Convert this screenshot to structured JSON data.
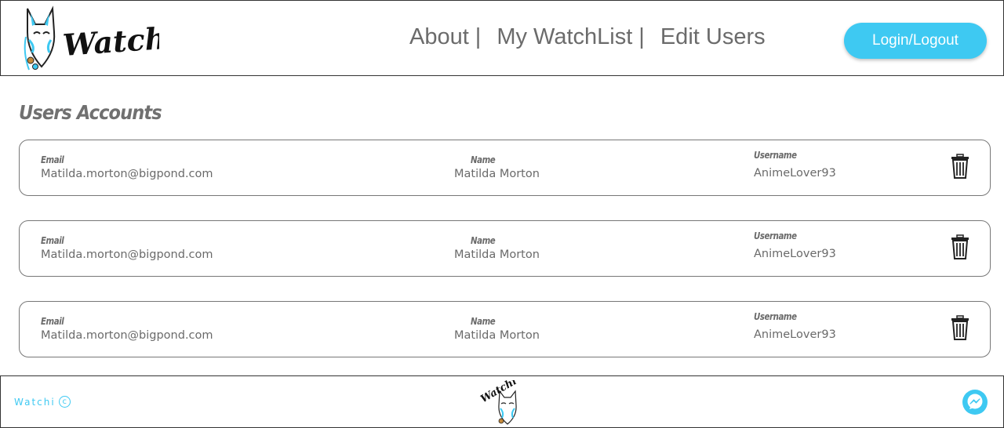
{
  "header": {
    "logo_text": "Watchi",
    "nav": [
      {
        "label": "About",
        "sep": "|"
      },
      {
        "label": "My WatchList",
        "sep": "|"
      },
      {
        "label": "Edit Users",
        "sep": ""
      }
    ],
    "login_label": "Login/Logout"
  },
  "page": {
    "title": "Users Accounts"
  },
  "labels": {
    "email": "Email",
    "name": "Name",
    "username": "Username"
  },
  "users": [
    {
      "email": "Matilda.morton@bigpond.com",
      "name": "Matilda Morton",
      "username": "AnimeLover93"
    },
    {
      "email": "Matilda.morton@bigpond.com",
      "name": "Matilda Morton",
      "username": "AnimeLover93"
    },
    {
      "email": "Matilda.morton@bigpond.com",
      "name": "Matilda Morton",
      "username": "AnimeLover93"
    }
  ],
  "footer": {
    "brand": "Watchi",
    "copyright_symbol": "c",
    "logo_text": "Watchi"
  },
  "icons": {
    "delete": "trash-icon",
    "chat": "messenger-icon"
  },
  "colors": {
    "accent": "#3ec9f2",
    "text": "#6b6b6b",
    "border": "#777777"
  }
}
